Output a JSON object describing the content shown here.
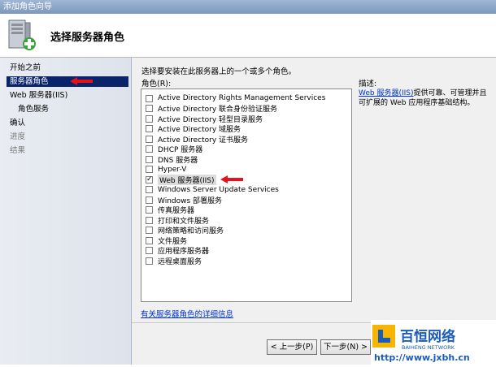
{
  "window": {
    "title": "添加角色向导"
  },
  "header": {
    "title": "选择服务器角色"
  },
  "sidebar": {
    "items": [
      {
        "label": "开始之前"
      },
      {
        "label": "服务器角色"
      },
      {
        "label": "Web 服务器(IIS)"
      },
      {
        "label": "角色服务"
      },
      {
        "label": "确认"
      },
      {
        "label": "进度"
      },
      {
        "label": "结果"
      }
    ]
  },
  "main": {
    "instruction": "选择要安装在此服务器上的一个或多个角色。",
    "roles_label": "角色(R):",
    "roles": [
      {
        "label": "Active Directory Rights Management Services",
        "checked": false
      },
      {
        "label": "Active Directory 联合身份验证服务",
        "checked": false
      },
      {
        "label": "Active Directory 轻型目录服务",
        "checked": false
      },
      {
        "label": "Active Directory 域服务",
        "checked": false
      },
      {
        "label": "Active Directory 证书服务",
        "checked": false
      },
      {
        "label": "DHCP 服务器",
        "checked": false
      },
      {
        "label": "DNS 服务器",
        "checked": false
      },
      {
        "label": "Hyper-V",
        "checked": false
      },
      {
        "label": "Web 服务器(IIS)",
        "checked": true
      },
      {
        "label": "Windows Server Update Services",
        "checked": false
      },
      {
        "label": "Windows 部署服务",
        "checked": false
      },
      {
        "label": "传真服务器",
        "checked": false
      },
      {
        "label": "打印和文件服务",
        "checked": false
      },
      {
        "label": "网络策略和访问服务",
        "checked": false
      },
      {
        "label": "文件服务",
        "checked": false
      },
      {
        "label": "应用程序服务器",
        "checked": false
      },
      {
        "label": "远程桌面服务",
        "checked": false
      }
    ],
    "description_title": "描述:",
    "description_link": "Web 服务器(IIS)",
    "description_text": "提供可靠、可管理并且可扩展的 Web 应用程序基础结构。",
    "more_info_link": "有关服务器角色的详细信息"
  },
  "buttons": {
    "prev": "< 上一步(P)",
    "next": "下一步(N) >"
  },
  "watermark": {
    "brand_cn": "百恒网络",
    "brand_en": "BAIHENG NETWORK",
    "url": "http://www.jxbh.cn"
  },
  "colors": {
    "selection": "#0a246a",
    "arrow": "#e8101a",
    "link": "#0033cc"
  }
}
